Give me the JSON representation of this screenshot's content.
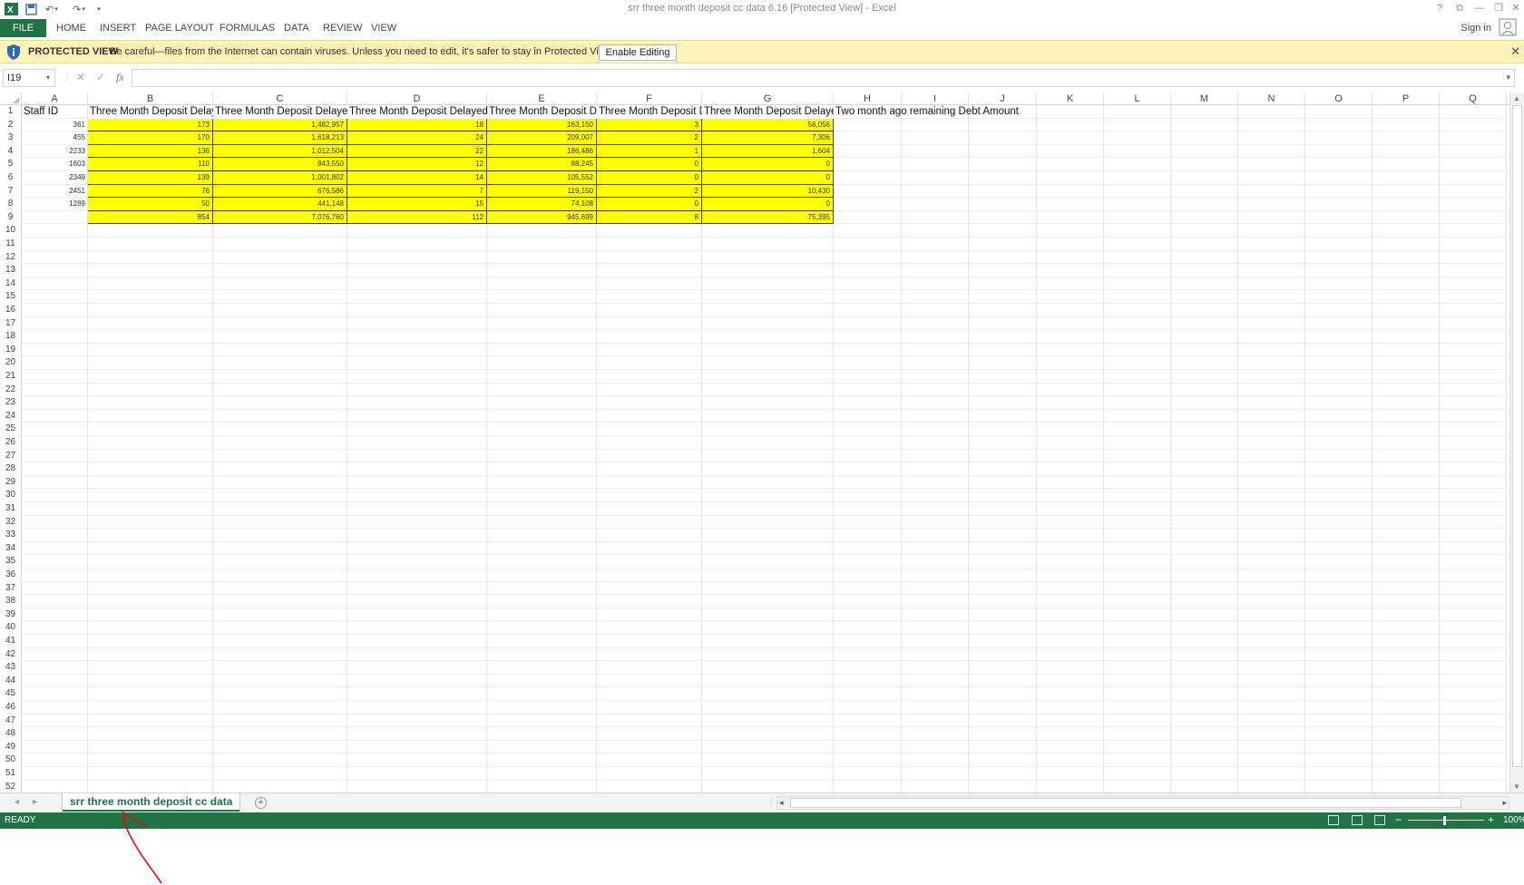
{
  "window": {
    "title": "srr three month deposit cc data 6.16  [Protected View] - Excel",
    "controls": [
      "?",
      "⧉",
      "—",
      "❐",
      "✕"
    ]
  },
  "ribbon": {
    "file": "FILE",
    "tabs": [
      "HOME",
      "INSERT",
      "PAGE LAYOUT",
      "FORMULAS",
      "DATA",
      "REVIEW",
      "VIEW"
    ],
    "sign_in": "Sign in"
  },
  "protected_view": {
    "label": "PROTECTED VIEW",
    "message": "Be careful—files from the Internet can contain viruses. Unless you need to edit, it's safer to stay in Protected View.",
    "button": "Enable Editing",
    "close": "✕"
  },
  "formula_bar": {
    "name_box": "I19",
    "fx": "fx",
    "value": ""
  },
  "sheet": {
    "columns": [
      "A",
      "B",
      "C",
      "D",
      "E",
      "F",
      "G",
      "H",
      "I",
      "J",
      "K",
      "L",
      "M",
      "N",
      "O",
      "P",
      "Q"
    ],
    "row_count": 52,
    "header_row": [
      "Staff ID",
      "Three Month Deposit Delayed",
      "Three Month Deposit Delayed",
      "Three Month Deposit Delayed",
      "Three Month Deposit Delayed",
      "Three Month Deposit Delayed",
      "Three Month Deposit Delayed",
      "Two month ago remaining Debt Amount"
    ],
    "rows": [
      [
        "361",
        "173",
        "1,482,957",
        "18",
        "163,150",
        "3",
        "56,056"
      ],
      [
        "455",
        "170",
        "1,618,213",
        "24",
        "209,007",
        "2",
        "7,306"
      ],
      [
        "2233",
        "136",
        "1,012,504",
        "22",
        "186,486",
        "1",
        "1,604"
      ],
      [
        "1603",
        "110",
        "843,550",
        "12",
        "88,245",
        "0",
        "0"
      ],
      [
        "2349",
        "139",
        "1,001,802",
        "14",
        "105,552",
        "0",
        "0"
      ],
      [
        "2451",
        "76",
        "676,586",
        "7",
        "119,150",
        "2",
        "10,430"
      ],
      [
        "1289",
        "50",
        "441,148",
        "15",
        "74,108",
        "0",
        "0"
      ],
      [
        "",
        "854",
        "7,076,760",
        "112",
        "945,699",
        "8",
        "75,395"
      ]
    ]
  },
  "sheet_tabs": {
    "active": "srr three month deposit cc data",
    "add": "+"
  },
  "status": {
    "text": "READY",
    "zoom": "100%"
  },
  "colors": {
    "excel_green": "#217346",
    "highlight": "#ffff00",
    "protected_bar": "#fbf3b8",
    "annotation": "#e01010"
  }
}
